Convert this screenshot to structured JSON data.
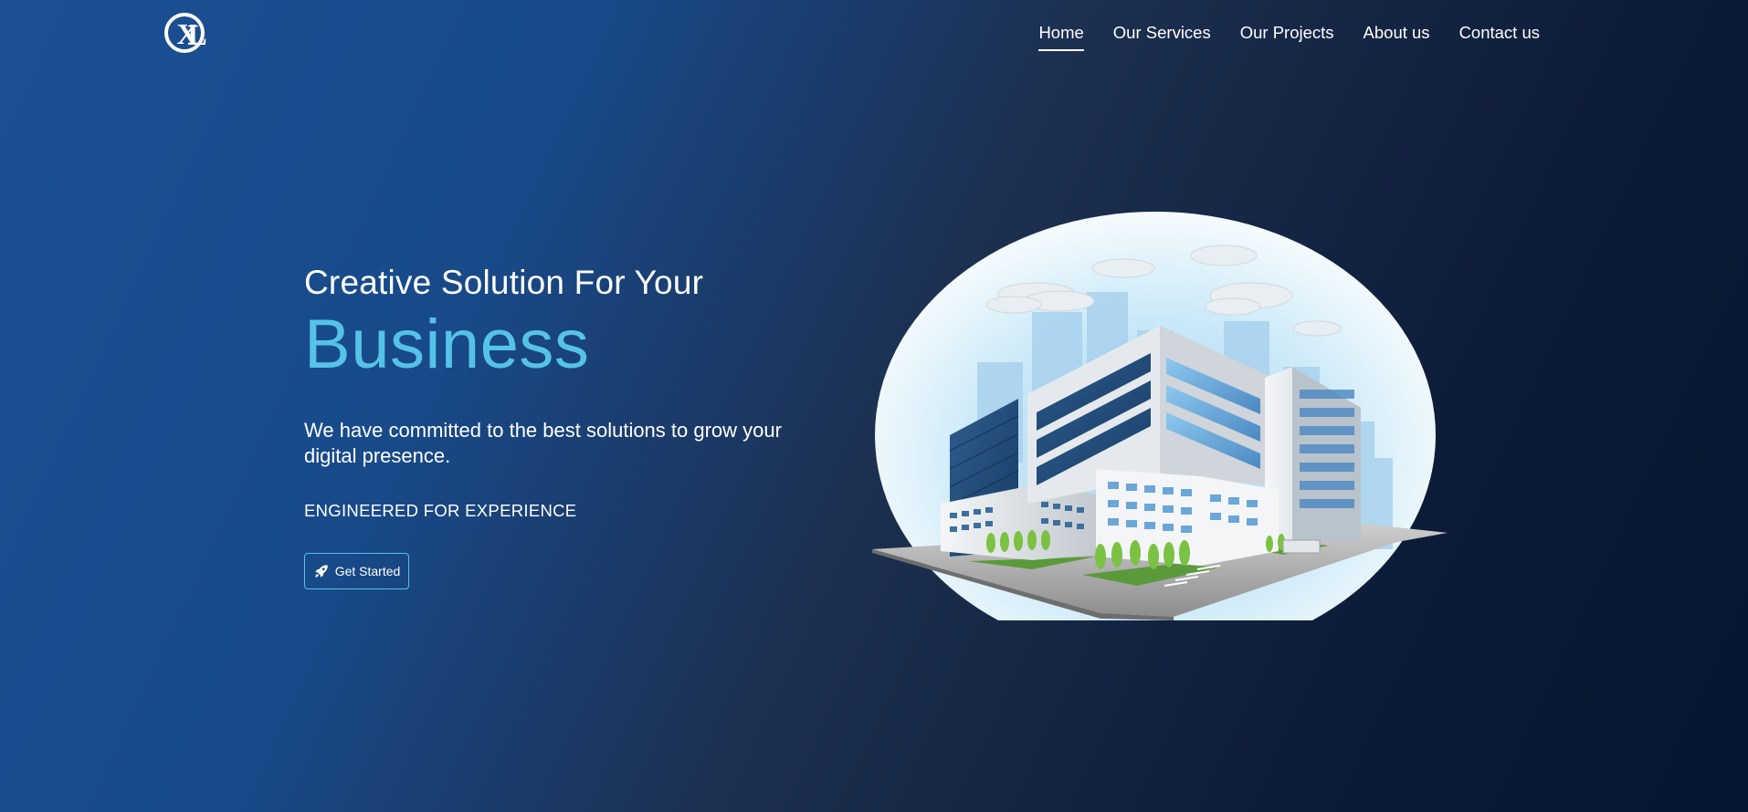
{
  "header": {
    "logo_alt": "XL",
    "nav": [
      {
        "label": "Home",
        "active": true
      },
      {
        "label": "Our Services",
        "active": false
      },
      {
        "label": "Our Projects",
        "active": false
      },
      {
        "label": "About us",
        "active": false
      },
      {
        "label": "Contact us",
        "active": false
      }
    ]
  },
  "hero": {
    "subtitle": "Creative Solution For Your",
    "title": "Business",
    "description": "We have committed to the best solutions to grow your digital presence.",
    "tagline": "ENGINEERED FOR EXPERIENCE",
    "cta_label": "Get Started",
    "cta_icon": "rocket-icon",
    "illustration": "office-building-illustration"
  },
  "colors": {
    "accent": "#55c2e8",
    "background_start": "#1b5093",
    "background_end": "#061631",
    "text": "#ffffff"
  }
}
